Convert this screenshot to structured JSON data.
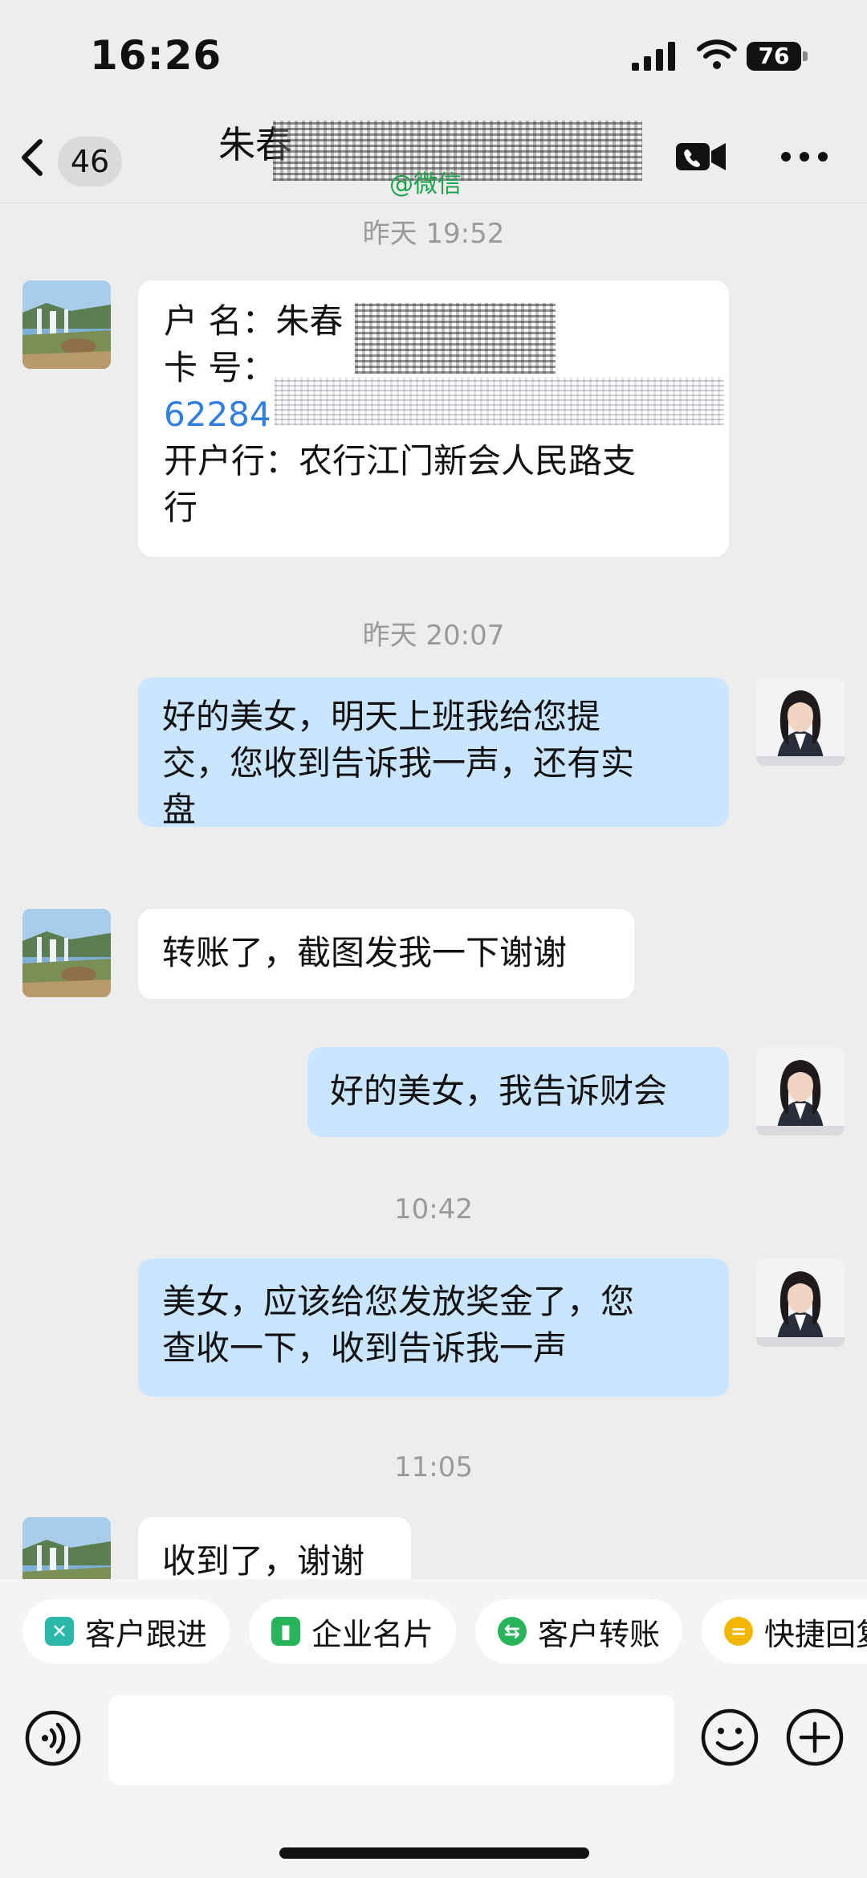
{
  "status_bar": {
    "time": "16:26",
    "battery": "76"
  },
  "header": {
    "back_count": "46",
    "contact_name_visible": "朱春",
    "source_tag": "@微信"
  },
  "messages": [
    {
      "type": "timestamp",
      "text": "昨天 19:52"
    },
    {
      "type": "incoming_card",
      "lines": {
        "name": "户  名：朱春",
        "card": "卡  号：",
        "number": "62284",
        "bank1": "开户行：农行江门新会人民路支",
        "bank2": "行"
      }
    },
    {
      "type": "timestamp",
      "text": "昨天 20:07"
    },
    {
      "type": "outgoing",
      "lines": [
        "好的美女，明天上班我给您提",
        "交，您收到告诉我一声，还有实",
        "盘"
      ]
    },
    {
      "type": "incoming",
      "text": "转账了，截图发我一下谢谢"
    },
    {
      "type": "outgoing",
      "lines": [
        "好的美女，我告诉财会"
      ]
    },
    {
      "type": "timestamp",
      "text": "10:42"
    },
    {
      "type": "outgoing",
      "lines": [
        "美女，应该给您发放奖金了，您",
        "查收一下，收到告诉我一声"
      ]
    },
    {
      "type": "timestamp",
      "text": "11:05"
    },
    {
      "type": "incoming",
      "text": "收到了，谢谢"
    }
  ],
  "quick_actions": [
    {
      "label": "客户跟进",
      "color": "#2BB8A8",
      "icon": "follow-up-icon"
    },
    {
      "label": "企业名片",
      "color": "#27B45A",
      "icon": "business-card-icon"
    },
    {
      "label": "客户转账",
      "color": "#27B45A",
      "icon": "transfer-icon"
    },
    {
      "label": "快捷回复",
      "color": "#F2B705",
      "icon": "quick-reply-icon"
    }
  ],
  "input": {
    "placeholder": ""
  },
  "colors": {
    "outgoing_bubble": "#C9E5FF",
    "incoming_bubble": "#FFFFFF",
    "background": "#EDEDED"
  }
}
